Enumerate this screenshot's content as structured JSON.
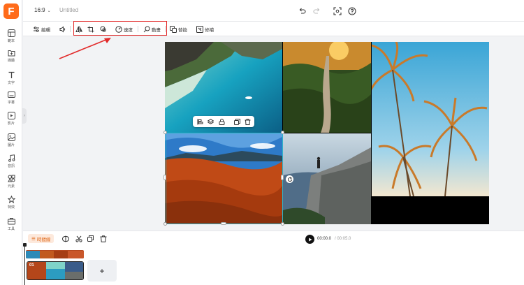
{
  "app": {
    "logo_letter": "F",
    "brand_color": "#ff6b1a"
  },
  "sidebar": {
    "items": [
      {
        "label": "範本",
        "icon": "template-icon"
      },
      {
        "label": "媒體",
        "icon": "upload-media-icon"
      },
      {
        "label": "文字",
        "icon": "text-icon"
      },
      {
        "label": "字幕",
        "icon": "subtitle-icon"
      },
      {
        "label": "影片",
        "icon": "video-icon"
      },
      {
        "label": "圖片",
        "icon": "image-icon"
      },
      {
        "label": "音訊",
        "icon": "music-icon"
      },
      {
        "label": "元素",
        "icon": "elements-icon"
      },
      {
        "label": "特效",
        "icon": "effects-icon"
      },
      {
        "label": "工具",
        "icon": "toolbox-icon"
      }
    ]
  },
  "topbar": {
    "ratio": "16:9",
    "title": "Untitled"
  },
  "toolbar": {
    "edit_label": "編輯",
    "speed_label": "速度",
    "animation_label": "動畫",
    "replace_label": "替換",
    "repair_label": "修補"
  },
  "timeline": {
    "badge_label": "時間線",
    "current_time": "00:00.0",
    "total_time": "/ 00:05.0",
    "clip_number": "01",
    "add_label": "+"
  },
  "colors": {
    "selection": "#2fb4c9",
    "annotation_red": "#e22a2a"
  }
}
